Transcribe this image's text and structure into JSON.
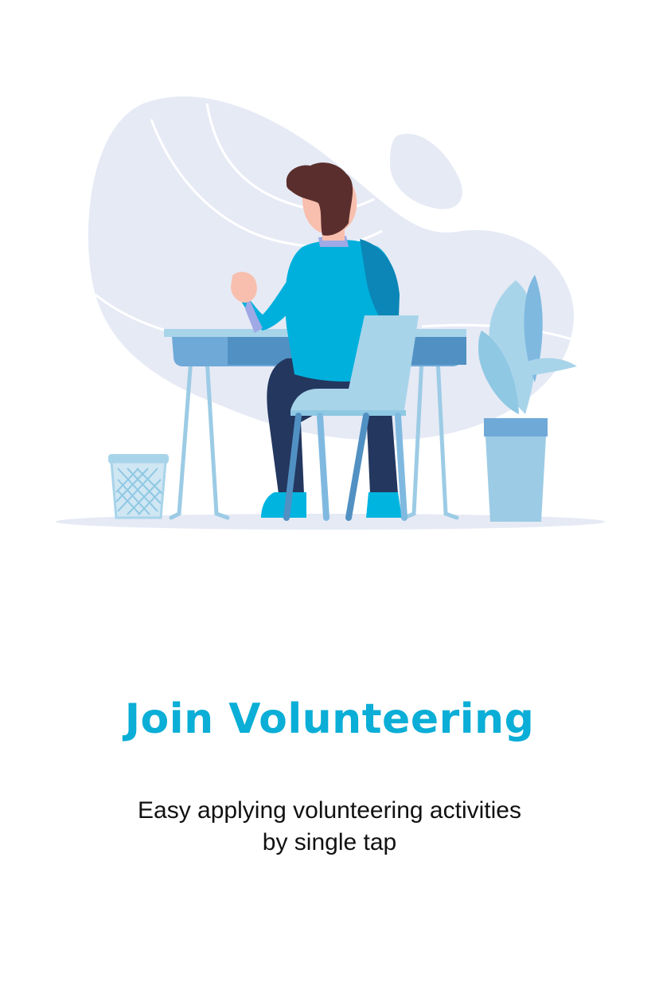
{
  "onboarding": {
    "title": "Join Volunteering",
    "subtitle_line1": "Easy applying volunteering activities",
    "subtitle_line2": "by single tap",
    "illustration_icon": "person-at-desk-illustration"
  },
  "colors": {
    "accent": "#0aaed6",
    "text": "#111111",
    "background": "#ffffff",
    "blob": "#e6eaf5"
  }
}
